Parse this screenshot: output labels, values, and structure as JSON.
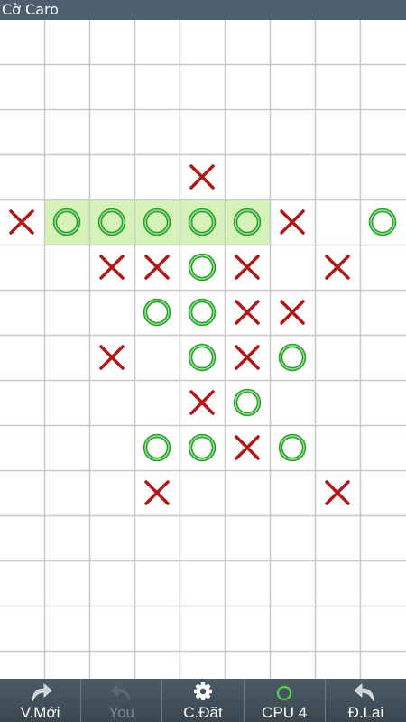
{
  "app": {
    "title": "Cờ Caro"
  },
  "board": {
    "cols": 9,
    "rows": 15,
    "grid_color": "#c8c8c8",
    "x_color": "#b01818",
    "o_color": "#2aa02a",
    "win_highlight": "#d5f2b8",
    "pieces": [
      {
        "row": 3,
        "col": 4,
        "mark": "X"
      },
      {
        "row": 4,
        "col": 0,
        "mark": "X"
      },
      {
        "row": 4,
        "col": 1,
        "mark": "O"
      },
      {
        "row": 4,
        "col": 2,
        "mark": "O"
      },
      {
        "row": 4,
        "col": 3,
        "mark": "O"
      },
      {
        "row": 4,
        "col": 4,
        "mark": "O"
      },
      {
        "row": 4,
        "col": 5,
        "mark": "O"
      },
      {
        "row": 4,
        "col": 6,
        "mark": "X"
      },
      {
        "row": 4,
        "col": 8,
        "mark": "O"
      },
      {
        "row": 5,
        "col": 2,
        "mark": "X"
      },
      {
        "row": 5,
        "col": 3,
        "mark": "X"
      },
      {
        "row": 5,
        "col": 4,
        "mark": "O"
      },
      {
        "row": 5,
        "col": 5,
        "mark": "X"
      },
      {
        "row": 5,
        "col": 7,
        "mark": "X"
      },
      {
        "row": 6,
        "col": 3,
        "mark": "O"
      },
      {
        "row": 6,
        "col": 4,
        "mark": "O"
      },
      {
        "row": 6,
        "col": 5,
        "mark": "X"
      },
      {
        "row": 6,
        "col": 6,
        "mark": "X"
      },
      {
        "row": 7,
        "col": 2,
        "mark": "X"
      },
      {
        "row": 7,
        "col": 4,
        "mark": "O"
      },
      {
        "row": 7,
        "col": 5,
        "mark": "X"
      },
      {
        "row": 7,
        "col": 6,
        "mark": "O"
      },
      {
        "row": 8,
        "col": 4,
        "mark": "X"
      },
      {
        "row": 8,
        "col": 5,
        "mark": "O"
      },
      {
        "row": 9,
        "col": 3,
        "mark": "O"
      },
      {
        "row": 9,
        "col": 4,
        "mark": "O"
      },
      {
        "row": 9,
        "col": 5,
        "mark": "X"
      },
      {
        "row": 9,
        "col": 6,
        "mark": "O"
      },
      {
        "row": 10,
        "col": 3,
        "mark": "X"
      },
      {
        "row": 10,
        "col": 7,
        "mark": "X"
      }
    ],
    "winning_cells": [
      {
        "row": 4,
        "col": 1
      },
      {
        "row": 4,
        "col": 2
      },
      {
        "row": 4,
        "col": 3
      },
      {
        "row": 4,
        "col": 4
      },
      {
        "row": 4,
        "col": 5
      }
    ]
  },
  "toolbar": {
    "new_game": {
      "label": "V.Mới",
      "icon": "redo-arrow-icon"
    },
    "you": {
      "label": "You",
      "icon": "undo-disabled-icon",
      "disabled": true
    },
    "settings": {
      "label": "C.Đăt",
      "icon": "gear-icon"
    },
    "cpu": {
      "label": "CPU 4",
      "icon": "o-piece-icon"
    },
    "undo": {
      "label": "Đ.Lai",
      "icon": "undo-arrow-icon"
    }
  }
}
